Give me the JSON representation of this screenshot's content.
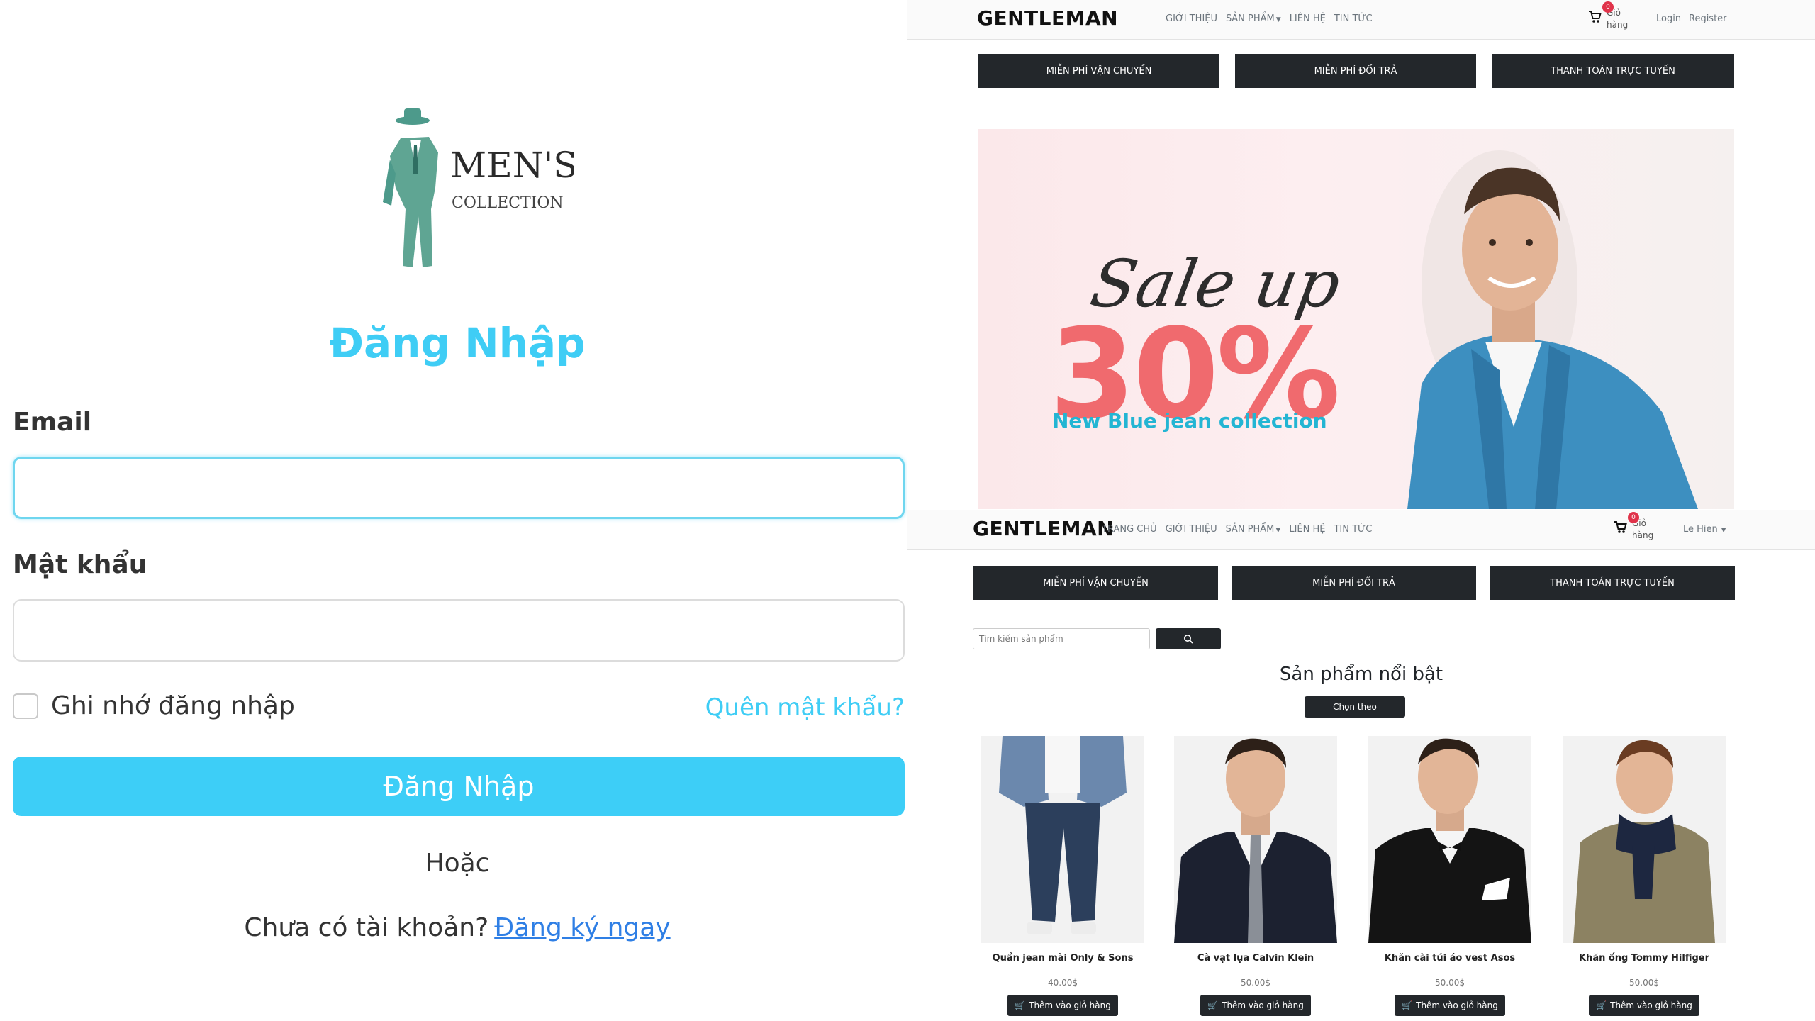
{
  "login": {
    "logo": {
      "line1": "MEN'S",
      "line2": "COLLECTION"
    },
    "title": "Đăng Nhập",
    "email_label": "Email",
    "email_value": "",
    "password_label": "Mật khẩu",
    "password_value": "",
    "remember_label": "Ghi nhớ đăng nhập",
    "remember_checked": false,
    "forgot_label": "Quên mật khẩu?",
    "submit_label": "Đăng Nhập",
    "or_text": "Hoặc",
    "no_account_text": "Chưa có tài khoản?",
    "register_link": "Đăng ký ngay",
    "accent_color": "#3fcdf5"
  },
  "shop_top": {
    "brand": "GENTLEMAN",
    "nav": [
      "GIỚI THIỆU",
      "SẢN PHẨM",
      "LIÊN HỆ",
      "TIN TỨC"
    ],
    "cart_label_1": "Giỏ",
    "cart_label_2": "hàng",
    "cart_count": "0",
    "login_link": "Login",
    "register_link": "Register",
    "promos": [
      "MIỄN PHÍ VẬN CHUYỂN",
      "MIỄN PHÍ ĐỔI TRẢ",
      "THANH TOÁN TRỰC TUYẾN"
    ],
    "banner": {
      "sale_text": "Sale up",
      "percent_text": "30%",
      "subtitle": "New Blue jean collection"
    }
  },
  "shop_bottom": {
    "brand": "GENTLEMAN",
    "nav": [
      "TRANG CHỦ",
      "GIỚI THIỆU",
      "SẢN PHẨM",
      "LIÊN HỆ",
      "TIN TỨC"
    ],
    "cart_label_1": "Giỏ",
    "cart_label_2": "hàng",
    "cart_count": "0",
    "user_menu": "Le Hien",
    "promos": [
      "MIỄN PHÍ VẬN CHUYỂN",
      "MIỄN PHÍ ĐỔI TRẢ",
      "THANH TOÁN TRỰC TUYẾN"
    ],
    "search_placeholder": "Tìm kiếm sản phẩm",
    "section_title": "Sản phẩm nổi bật",
    "sort_label": "Chọn theo",
    "add_to_cart_label": "Thêm vào giỏ hàng",
    "products": [
      {
        "name": "Quần jean mài Only & Sons",
        "price": "40.00$"
      },
      {
        "name": "Cà vạt lụa Calvin Klein",
        "price": "50.00$"
      },
      {
        "name": "Khăn cài túi áo vest Asos",
        "price": "50.00$"
      },
      {
        "name": "Khăn ống Tommy Hilfiger",
        "price": "50.00$"
      }
    ]
  }
}
